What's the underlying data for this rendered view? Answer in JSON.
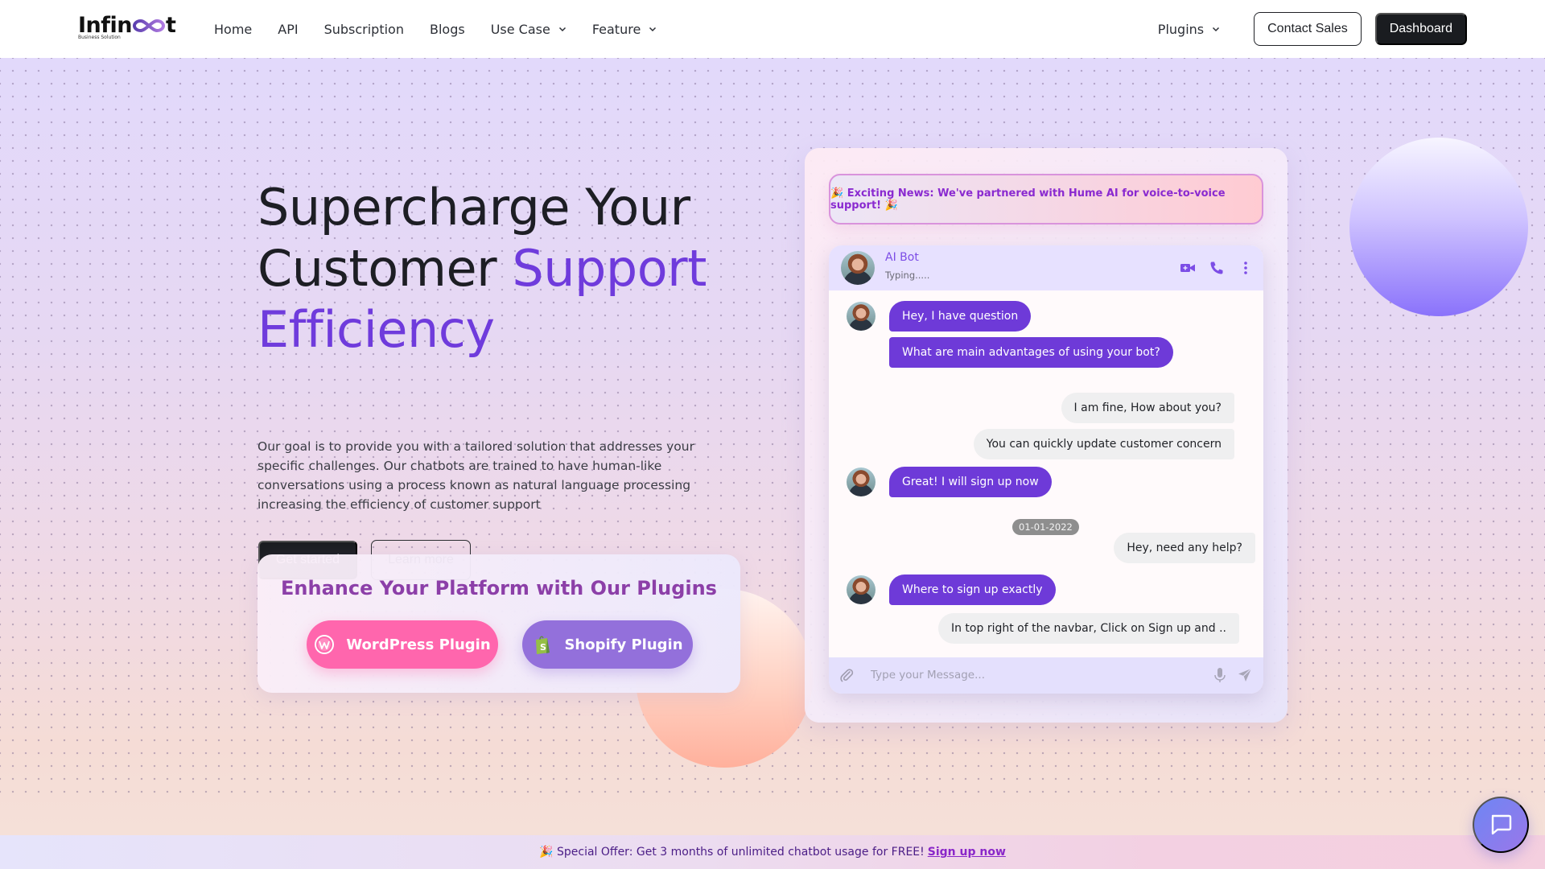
{
  "brand": {
    "name_prefix": "Infin",
    "name_suffix": "t",
    "tagline": "Business Solution"
  },
  "nav": {
    "links": [
      {
        "label": "Home",
        "has_dropdown": false
      },
      {
        "label": "API",
        "has_dropdown": false
      },
      {
        "label": "Subscription",
        "has_dropdown": false
      },
      {
        "label": "Blogs",
        "has_dropdown": false
      },
      {
        "label": "Use Case",
        "has_dropdown": true
      },
      {
        "label": "Feature",
        "has_dropdown": true
      }
    ],
    "plugins_label": "Plugins",
    "contact_sales_label": "Contact Sales",
    "dashboard_label": "Dashboard"
  },
  "hero": {
    "title_line1": "Supercharge Your",
    "title_line2_plain": "Customer",
    "title_line2_accent": "Support",
    "title_line3_accent": "Efficiency",
    "description": "Our goal is to provide you with a tailored solution that addresses your specific challenges. Our chatbots are trained to have human-like conversations using a process known as natural language processing increasing the efficiency of customer support",
    "get_started_label": "Get started",
    "learn_more_label": "Learn more"
  },
  "plugins_card": {
    "title": "Enhance Your Platform with Our Plugins",
    "wordpress_label": "WordPress Plugin",
    "shopify_label": "Shopify Plugin"
  },
  "news_banner": {
    "text": "🎉 Exciting News: We've partnered with Hume AI for voice-to-voice support! 🎉"
  },
  "chat": {
    "bot_name": "AI Bot",
    "status": "Typing.....",
    "messages": [
      {
        "side": "left",
        "text": "Hey, I have question"
      },
      {
        "side": "left",
        "text": "What are main advantages of using your bot?"
      },
      {
        "side": "right",
        "text": "I am fine, How about you?"
      },
      {
        "side": "right",
        "text": "You can quickly update customer concern"
      },
      {
        "side": "left",
        "text": "Great! I will sign up now"
      },
      {
        "side": "right",
        "text": "Hey, need any help?"
      },
      {
        "side": "left",
        "text": "Where to sign up exactly"
      },
      {
        "side": "right",
        "text": "In top right of the navbar, Click on Sign up and .."
      }
    ],
    "date_separator": "01-01-2022",
    "input_placeholder": "Type your Message...",
    "input_value": ""
  },
  "promo": {
    "text": "🎉 Special Offer: Get 3 months of unlimited chatbot usage for FREE!",
    "link_label": "Sign up now"
  },
  "colors": {
    "accent_purple": "#6f3bdc",
    "plugins_title": "#8c3fa8",
    "wordpress_pink": "#ff66ad",
    "shopify_purple": "#9370db",
    "dark_button": "#1b1d21"
  }
}
